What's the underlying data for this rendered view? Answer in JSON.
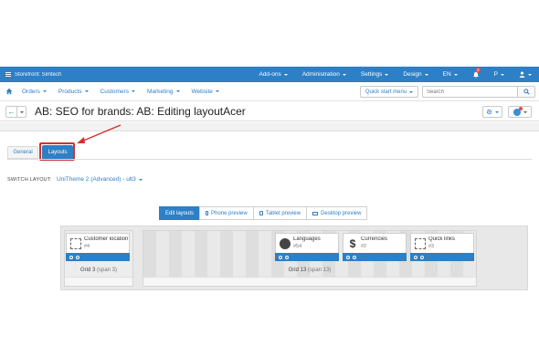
{
  "topbar": {
    "store": "Storefront: Simtech",
    "items": [
      {
        "label": "Add-ons"
      },
      {
        "label": "Administration"
      },
      {
        "label": "Settings"
      },
      {
        "label": "Design"
      },
      {
        "label": "EN"
      }
    ],
    "notification_count": "2",
    "user_initial": "P"
  },
  "menu": {
    "items": [
      "Orders",
      "Products",
      "Customers",
      "Marketing",
      "Website"
    ],
    "quick_start": "Quick start menu",
    "search_placeholder": "Search"
  },
  "title": "AB: SEO for brands: AB: Editing layoutAcer",
  "tabs": [
    {
      "label": "General"
    },
    {
      "label": "Layouts",
      "active": true
    }
  ],
  "switch_layout": {
    "label": "SWITCH LAYOUT:",
    "value": "UniTheme 2 (Advanced) - ult3"
  },
  "view_tabs": [
    {
      "label": "Edit layouts",
      "active": true
    },
    {
      "label": "Phone preview"
    },
    {
      "label": "Tablet preview"
    },
    {
      "label": "Desktop preview"
    }
  ],
  "grids": [
    {
      "label": "Grid 3",
      "span": "(span 3)"
    },
    {
      "label": "Grid 13",
      "span": "(span 13)"
    }
  ],
  "blocks": [
    {
      "name": "Customer location",
      "id": "#4",
      "icon": "placeholder-icon"
    },
    {
      "name": "Languages",
      "id": "#54",
      "icon": "globe-icon"
    },
    {
      "name": "Currencies",
      "id": "#2",
      "icon": "dollar-icon"
    },
    {
      "name": "Quick links",
      "id": "#3",
      "icon": "placeholder-icon"
    }
  ],
  "colors": {
    "primary": "#2d7fc6",
    "highlight": "#d6302c"
  }
}
